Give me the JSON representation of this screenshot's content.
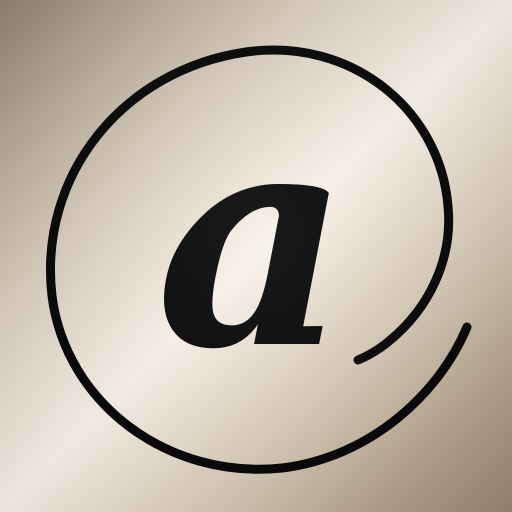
{
  "icon": {
    "name": "at-sign-icon",
    "glyph": "@"
  },
  "colors": {
    "symbol": "#000000",
    "background_light": "#f8f2ea",
    "background_dark": "#8e8170"
  }
}
